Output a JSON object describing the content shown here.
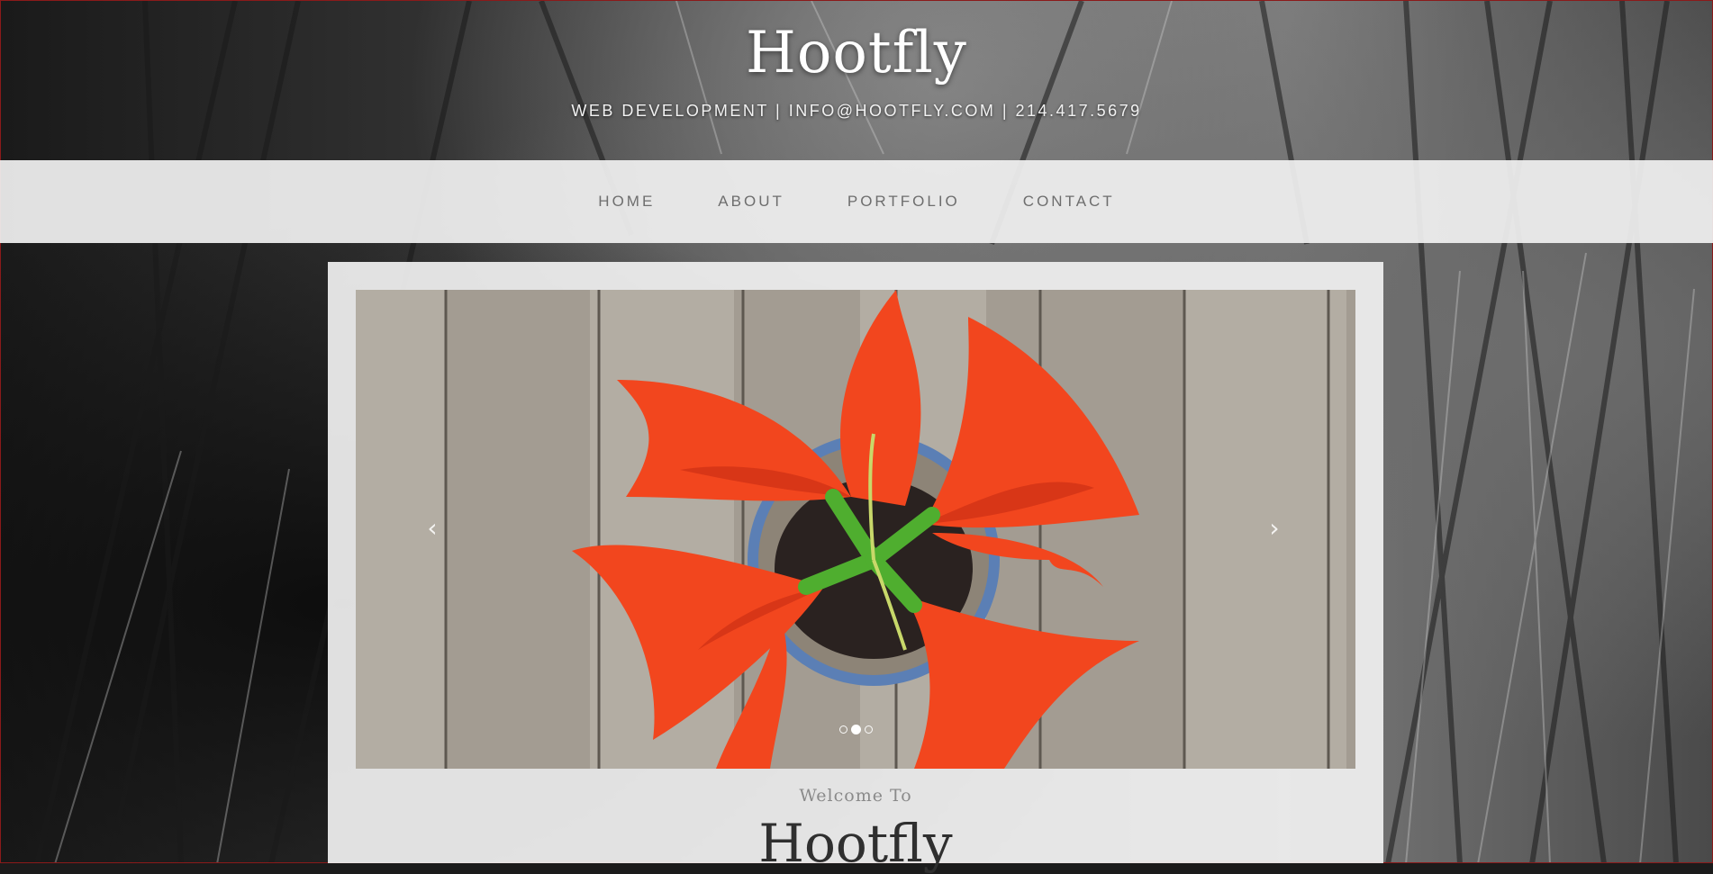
{
  "header": {
    "title": "Hootfly",
    "tagline": "WEB DEVELOPMENT | INFO@HOOTFLY.COM | 214.417.5679"
  },
  "nav": {
    "items": [
      {
        "label": "HOME"
      },
      {
        "label": "ABOUT"
      },
      {
        "label": "PORTFOLIO"
      },
      {
        "label": "CONTACT"
      }
    ]
  },
  "slider": {
    "prev_label": "‹",
    "next_label": "›",
    "slide_count": 3,
    "active_slide": 2,
    "image_description_icon": "red-amaryllis-flowers-photo"
  },
  "intro": {
    "welcome": "Welcome To",
    "title": "Hootfly"
  },
  "colors": {
    "accent_flower": "#f2461e",
    "panel": "#f0f0f0",
    "border": "#8b1a1a"
  }
}
